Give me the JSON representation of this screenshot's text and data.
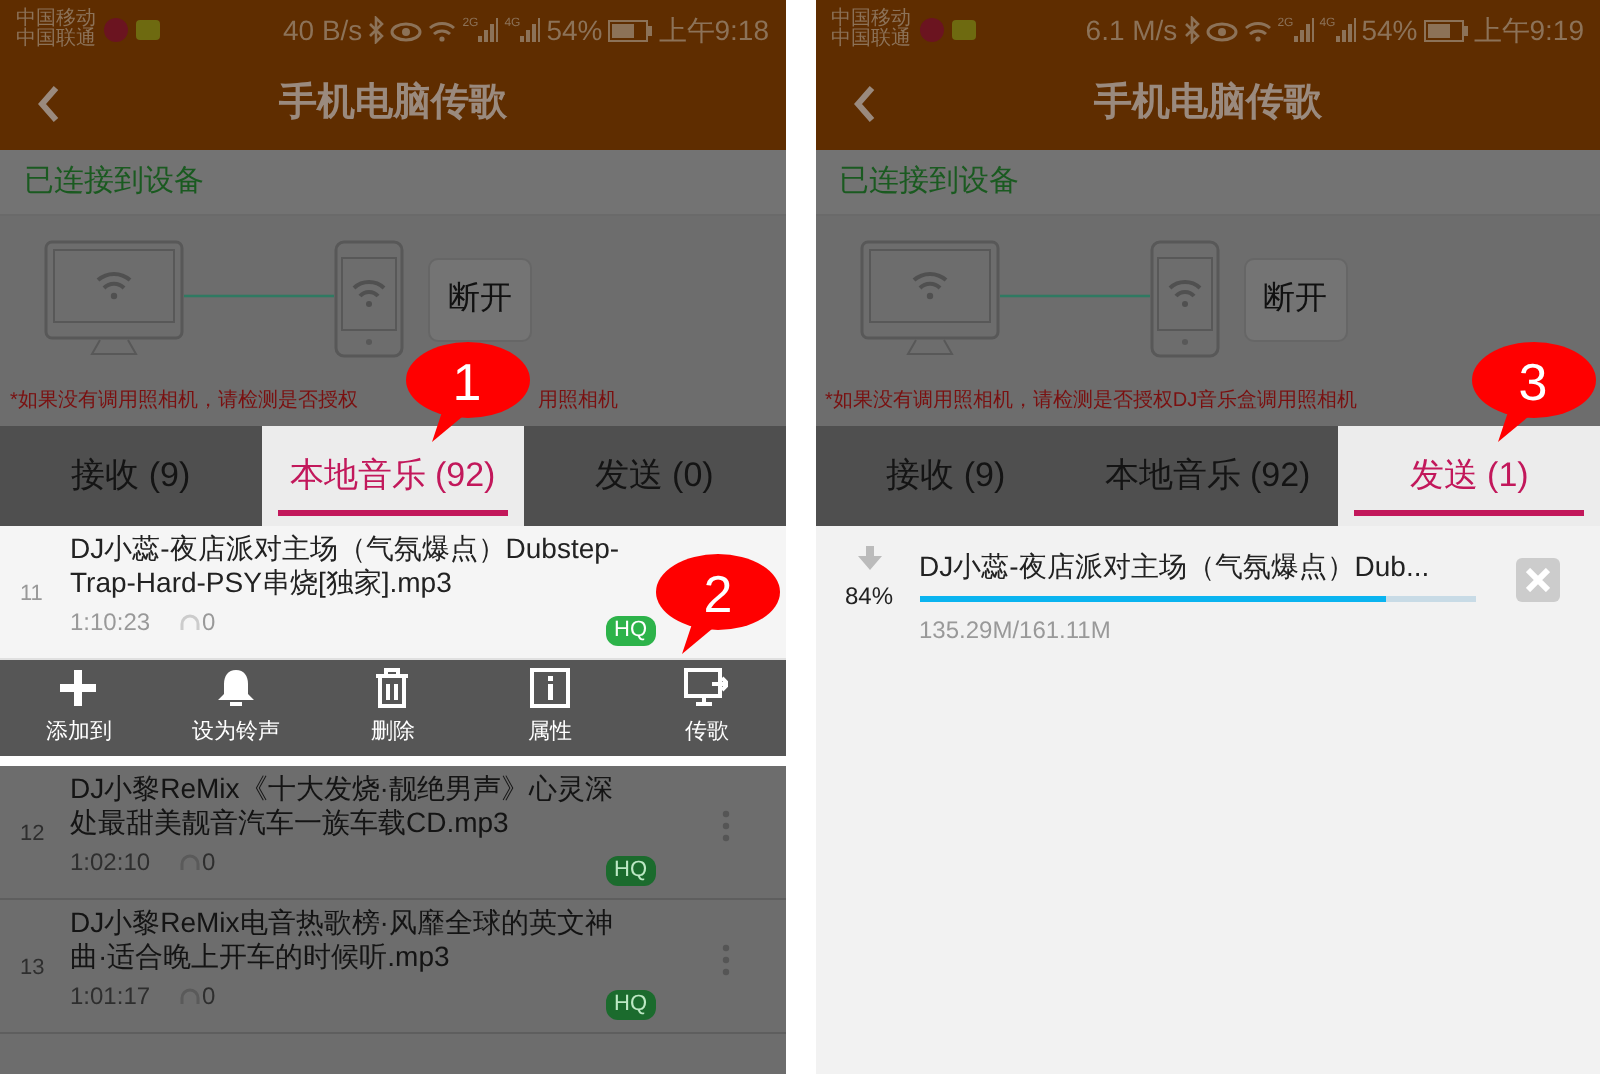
{
  "panels": [
    {
      "status_bar": {
        "carrier_1": "中国移动",
        "carrier_2": "中国联通",
        "speed": "40 B/s",
        "network_1": "2G",
        "network_2": "4G",
        "battery": "54%",
        "time": "上午9:18"
      },
      "header": {
        "title": "手机电脑传歌"
      },
      "connection_label": "已连接到设备",
      "disconnect_button": "断开",
      "warning": [
        "*如果没有调用照相机，请检测是否授权",
        "用照相机"
      ],
      "tabs": [
        {
          "label": "接收 (9)",
          "selected": false
        },
        {
          "label": "本地音乐 (92)",
          "selected": true,
          "callout": "1"
        },
        {
          "label": "发送 (0)",
          "selected": false
        }
      ],
      "tracks": [
        {
          "number": "11",
          "title": "DJ小蕊-夜店派对主场（气氛爆点）Dubstep-Trap-Hard-PSY串烧[独家].mp3",
          "duration": "1:10:23",
          "plays": "0",
          "badge": "HQ",
          "highlighted": true
        },
        {
          "kind": "actions",
          "actions": [
            {
              "kind": "plus",
              "label": "添加到"
            },
            {
              "kind": "bell",
              "label": "设为铃声"
            },
            {
              "kind": "trash",
              "label": "删除"
            },
            {
              "kind": "info",
              "label": "属性"
            },
            {
              "kind": "transfer",
              "label": "传歌",
              "callout": "2"
            }
          ]
        },
        {
          "number": "12",
          "title": "DJ小黎ReMix《十大发烧·靓绝男声》心灵深处最甜美靓音汽车一族车载CD.mp3",
          "duration": "1:02:10",
          "plays": "0",
          "badge": "HQ",
          "highlighted": false
        },
        {
          "number": "13",
          "title": "DJ小黎ReMix电音热歌榜·风靡全球的英文神曲·适合晚上开车的时候听.mp3",
          "duration": "1:01:17",
          "plays": "0",
          "badge": "HQ",
          "highlighted": false
        }
      ]
    },
    {
      "status_bar": {
        "carrier_1": "中国移动",
        "carrier_2": "中国联通",
        "speed": "6.1 M/s",
        "network_1": "2G",
        "network_2": "4G",
        "battery": "54%",
        "time": "上午9:19"
      },
      "header": {
        "title": "手机电脑传歌"
      },
      "connection_label": "已连接到设备",
      "disconnect_button": "断开",
      "warning": [
        "*如果没有调用照相机，请检测是否授权DJ音乐盒调用照相机"
      ],
      "tabs": [
        {
          "label": "接收 (9)",
          "selected": false
        },
        {
          "label": "本地音乐 (92)",
          "selected": false
        },
        {
          "label": "发送 (1)",
          "selected": true,
          "callout": "3"
        }
      ],
      "transfers": [
        {
          "title": "DJ小蕊-夜店派对主场（气氛爆点）Dub...",
          "percent": "84%",
          "level": 0.84,
          "size": "135.29M/161.11M"
        }
      ]
    }
  ]
}
